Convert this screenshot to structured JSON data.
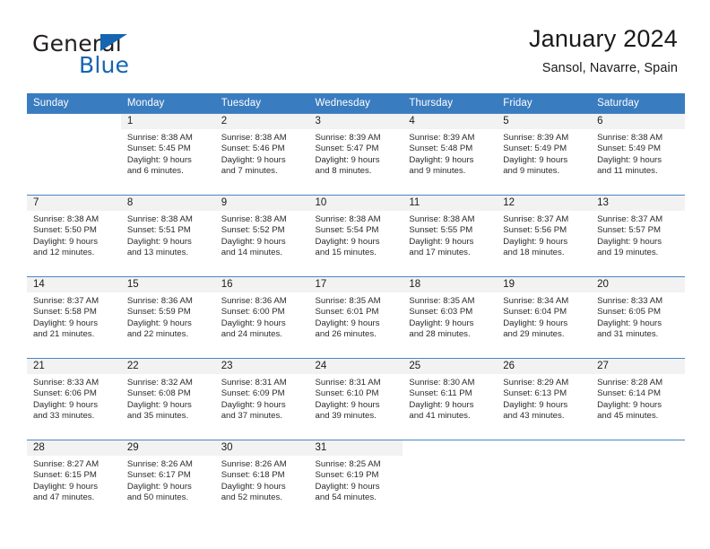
{
  "logo": {
    "word_one": "General",
    "word_two": "Blue",
    "flag_icon": "triangle-flag-icon",
    "accent_color": "#1565b0"
  },
  "header": {
    "title": "January 2024",
    "subtitle": "Sansol, Navarre, Spain"
  },
  "calendar": {
    "header_bg": "#3a7cc0",
    "daynum_bg": "#f2f2f2",
    "grid_line_color": "#4a86c5",
    "weekday_headers": [
      "Sunday",
      "Monday",
      "Tuesday",
      "Wednesday",
      "Thursday",
      "Friday",
      "Saturday"
    ],
    "weeks": [
      [
        {
          "day": ""
        },
        {
          "day": "1",
          "sunrise": "Sunrise: 8:38 AM",
          "sunset": "Sunset: 5:45 PM",
          "daylight_1": "Daylight: 9 hours",
          "daylight_2": "and 6 minutes."
        },
        {
          "day": "2",
          "sunrise": "Sunrise: 8:38 AM",
          "sunset": "Sunset: 5:46 PM",
          "daylight_1": "Daylight: 9 hours",
          "daylight_2": "and 7 minutes."
        },
        {
          "day": "3",
          "sunrise": "Sunrise: 8:39 AM",
          "sunset": "Sunset: 5:47 PM",
          "daylight_1": "Daylight: 9 hours",
          "daylight_2": "and 8 minutes."
        },
        {
          "day": "4",
          "sunrise": "Sunrise: 8:39 AM",
          "sunset": "Sunset: 5:48 PM",
          "daylight_1": "Daylight: 9 hours",
          "daylight_2": "and 9 minutes."
        },
        {
          "day": "5",
          "sunrise": "Sunrise: 8:39 AM",
          "sunset": "Sunset: 5:49 PM",
          "daylight_1": "Daylight: 9 hours",
          "daylight_2": "and 9 minutes."
        },
        {
          "day": "6",
          "sunrise": "Sunrise: 8:38 AM",
          "sunset": "Sunset: 5:49 PM",
          "daylight_1": "Daylight: 9 hours",
          "daylight_2": "and 11 minutes."
        }
      ],
      [
        {
          "day": "7",
          "sunrise": "Sunrise: 8:38 AM",
          "sunset": "Sunset: 5:50 PM",
          "daylight_1": "Daylight: 9 hours",
          "daylight_2": "and 12 minutes."
        },
        {
          "day": "8",
          "sunrise": "Sunrise: 8:38 AM",
          "sunset": "Sunset: 5:51 PM",
          "daylight_1": "Daylight: 9 hours",
          "daylight_2": "and 13 minutes."
        },
        {
          "day": "9",
          "sunrise": "Sunrise: 8:38 AM",
          "sunset": "Sunset: 5:52 PM",
          "daylight_1": "Daylight: 9 hours",
          "daylight_2": "and 14 minutes."
        },
        {
          "day": "10",
          "sunrise": "Sunrise: 8:38 AM",
          "sunset": "Sunset: 5:54 PM",
          "daylight_1": "Daylight: 9 hours",
          "daylight_2": "and 15 minutes."
        },
        {
          "day": "11",
          "sunrise": "Sunrise: 8:38 AM",
          "sunset": "Sunset: 5:55 PM",
          "daylight_1": "Daylight: 9 hours",
          "daylight_2": "and 17 minutes."
        },
        {
          "day": "12",
          "sunrise": "Sunrise: 8:37 AM",
          "sunset": "Sunset: 5:56 PM",
          "daylight_1": "Daylight: 9 hours",
          "daylight_2": "and 18 minutes."
        },
        {
          "day": "13",
          "sunrise": "Sunrise: 8:37 AM",
          "sunset": "Sunset: 5:57 PM",
          "daylight_1": "Daylight: 9 hours",
          "daylight_2": "and 19 minutes."
        }
      ],
      [
        {
          "day": "14",
          "sunrise": "Sunrise: 8:37 AM",
          "sunset": "Sunset: 5:58 PM",
          "daylight_1": "Daylight: 9 hours",
          "daylight_2": "and 21 minutes."
        },
        {
          "day": "15",
          "sunrise": "Sunrise: 8:36 AM",
          "sunset": "Sunset: 5:59 PM",
          "daylight_1": "Daylight: 9 hours",
          "daylight_2": "and 22 minutes."
        },
        {
          "day": "16",
          "sunrise": "Sunrise: 8:36 AM",
          "sunset": "Sunset: 6:00 PM",
          "daylight_1": "Daylight: 9 hours",
          "daylight_2": "and 24 minutes."
        },
        {
          "day": "17",
          "sunrise": "Sunrise: 8:35 AM",
          "sunset": "Sunset: 6:01 PM",
          "daylight_1": "Daylight: 9 hours",
          "daylight_2": "and 26 minutes."
        },
        {
          "day": "18",
          "sunrise": "Sunrise: 8:35 AM",
          "sunset": "Sunset: 6:03 PM",
          "daylight_1": "Daylight: 9 hours",
          "daylight_2": "and 28 minutes."
        },
        {
          "day": "19",
          "sunrise": "Sunrise: 8:34 AM",
          "sunset": "Sunset: 6:04 PM",
          "daylight_1": "Daylight: 9 hours",
          "daylight_2": "and 29 minutes."
        },
        {
          "day": "20",
          "sunrise": "Sunrise: 8:33 AM",
          "sunset": "Sunset: 6:05 PM",
          "daylight_1": "Daylight: 9 hours",
          "daylight_2": "and 31 minutes."
        }
      ],
      [
        {
          "day": "21",
          "sunrise": "Sunrise: 8:33 AM",
          "sunset": "Sunset: 6:06 PM",
          "daylight_1": "Daylight: 9 hours",
          "daylight_2": "and 33 minutes."
        },
        {
          "day": "22",
          "sunrise": "Sunrise: 8:32 AM",
          "sunset": "Sunset: 6:08 PM",
          "daylight_1": "Daylight: 9 hours",
          "daylight_2": "and 35 minutes."
        },
        {
          "day": "23",
          "sunrise": "Sunrise: 8:31 AM",
          "sunset": "Sunset: 6:09 PM",
          "daylight_1": "Daylight: 9 hours",
          "daylight_2": "and 37 minutes."
        },
        {
          "day": "24",
          "sunrise": "Sunrise: 8:31 AM",
          "sunset": "Sunset: 6:10 PM",
          "daylight_1": "Daylight: 9 hours",
          "daylight_2": "and 39 minutes."
        },
        {
          "day": "25",
          "sunrise": "Sunrise: 8:30 AM",
          "sunset": "Sunset: 6:11 PM",
          "daylight_1": "Daylight: 9 hours",
          "daylight_2": "and 41 minutes."
        },
        {
          "day": "26",
          "sunrise": "Sunrise: 8:29 AM",
          "sunset": "Sunset: 6:13 PM",
          "daylight_1": "Daylight: 9 hours",
          "daylight_2": "and 43 minutes."
        },
        {
          "day": "27",
          "sunrise": "Sunrise: 8:28 AM",
          "sunset": "Sunset: 6:14 PM",
          "daylight_1": "Daylight: 9 hours",
          "daylight_2": "and 45 minutes."
        }
      ],
      [
        {
          "day": "28",
          "sunrise": "Sunrise: 8:27 AM",
          "sunset": "Sunset: 6:15 PM",
          "daylight_1": "Daylight: 9 hours",
          "daylight_2": "and 47 minutes."
        },
        {
          "day": "29",
          "sunrise": "Sunrise: 8:26 AM",
          "sunset": "Sunset: 6:17 PM",
          "daylight_1": "Daylight: 9 hours",
          "daylight_2": "and 50 minutes."
        },
        {
          "day": "30",
          "sunrise": "Sunrise: 8:26 AM",
          "sunset": "Sunset: 6:18 PM",
          "daylight_1": "Daylight: 9 hours",
          "daylight_2": "and 52 minutes."
        },
        {
          "day": "31",
          "sunrise": "Sunrise: 8:25 AM",
          "sunset": "Sunset: 6:19 PM",
          "daylight_1": "Daylight: 9 hours",
          "daylight_2": "and 54 minutes."
        },
        {
          "day": ""
        },
        {
          "day": ""
        },
        {
          "day": ""
        }
      ]
    ]
  }
}
